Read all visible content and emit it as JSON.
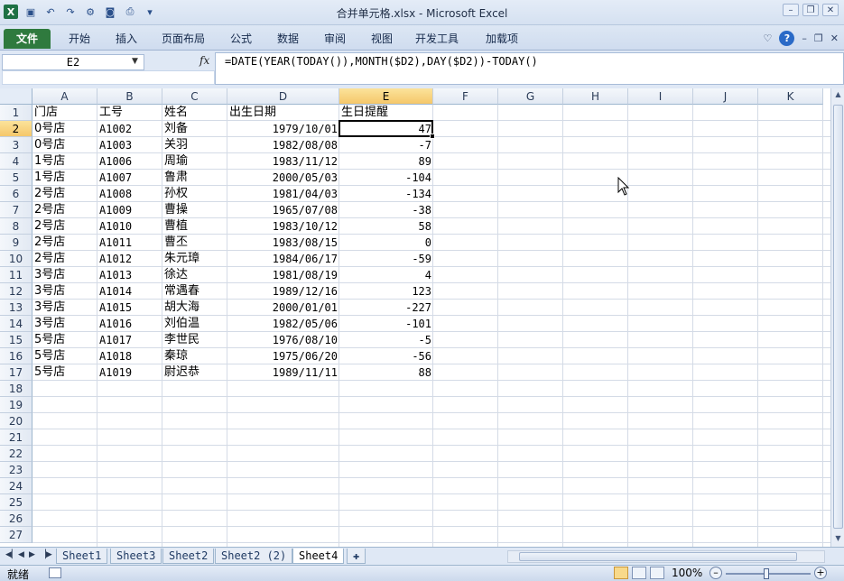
{
  "window": {
    "title": "合并单元格.xlsx - Microsoft Excel"
  },
  "ribbon": {
    "tabs": [
      "文件",
      "开始",
      "插入",
      "页面布局",
      "公式",
      "数据",
      "审阅",
      "视图",
      "开发工具",
      "加载项"
    ]
  },
  "formula_bar": {
    "name_box": "E2",
    "fx_label": "fx",
    "formula": "=DATE(YEAR(TODAY()),MONTH($D2),DAY($D2))-TODAY()"
  },
  "columns": [
    "A",
    "B",
    "C",
    "D",
    "E",
    "F",
    "G",
    "H",
    "I",
    "J",
    "K"
  ],
  "selected_column": "E",
  "selected_row": 2,
  "row_numbers": [
    1,
    2,
    3,
    4,
    5,
    6,
    7,
    8,
    9,
    10,
    11,
    12,
    13,
    14,
    15,
    16,
    17,
    18,
    19,
    20,
    21,
    22,
    23,
    24,
    25,
    26,
    27
  ],
  "headers": [
    "门店",
    "工号",
    "姓名",
    "出生日期",
    "生日提醒"
  ],
  "rows": [
    [
      "0号店",
      "A1002",
      "刘备",
      "1979/10/01",
      "47"
    ],
    [
      "0号店",
      "A1003",
      "关羽",
      "1982/08/08",
      "-7"
    ],
    [
      "1号店",
      "A1006",
      "周瑜",
      "1983/11/12",
      "89"
    ],
    [
      "1号店",
      "A1007",
      "鲁肃",
      "2000/05/03",
      "-104"
    ],
    [
      "2号店",
      "A1008",
      "孙权",
      "1981/04/03",
      "-134"
    ],
    [
      "2号店",
      "A1009",
      "曹操",
      "1965/07/08",
      "-38"
    ],
    [
      "2号店",
      "A1010",
      "曹植",
      "1983/10/12",
      "58"
    ],
    [
      "2号店",
      "A1011",
      "曹丕",
      "1983/08/15",
      "0"
    ],
    [
      "2号店",
      "A1012",
      "朱元璋",
      "1984/06/17",
      "-59"
    ],
    [
      "3号店",
      "A1013",
      "徐达",
      "1981/08/19",
      "4"
    ],
    [
      "3号店",
      "A1014",
      "常遇春",
      "1989/12/16",
      "123"
    ],
    [
      "3号店",
      "A1015",
      "胡大海",
      "2000/01/01",
      "-227"
    ],
    [
      "3号店",
      "A1016",
      "刘伯温",
      "1982/05/06",
      "-101"
    ],
    [
      "5号店",
      "A1017",
      "李世民",
      "1976/08/10",
      "-5"
    ],
    [
      "5号店",
      "A1018",
      "秦琼",
      "1975/06/20",
      "-56"
    ],
    [
      "5号店",
      "A1019",
      "尉迟恭",
      "1989/11/11",
      "88"
    ]
  ],
  "sheets": [
    "Sheet1",
    "Sheet3",
    "Sheet2",
    "Sheet2 (2)",
    "Sheet4"
  ],
  "active_sheet": "Sheet4",
  "status": {
    "ready": "就绪",
    "zoom": "100%"
  },
  "colors": {
    "file_tab": "#2f7a3e",
    "selection_header": "#f5c76a",
    "grid_line": "#d4dbe6"
  }
}
